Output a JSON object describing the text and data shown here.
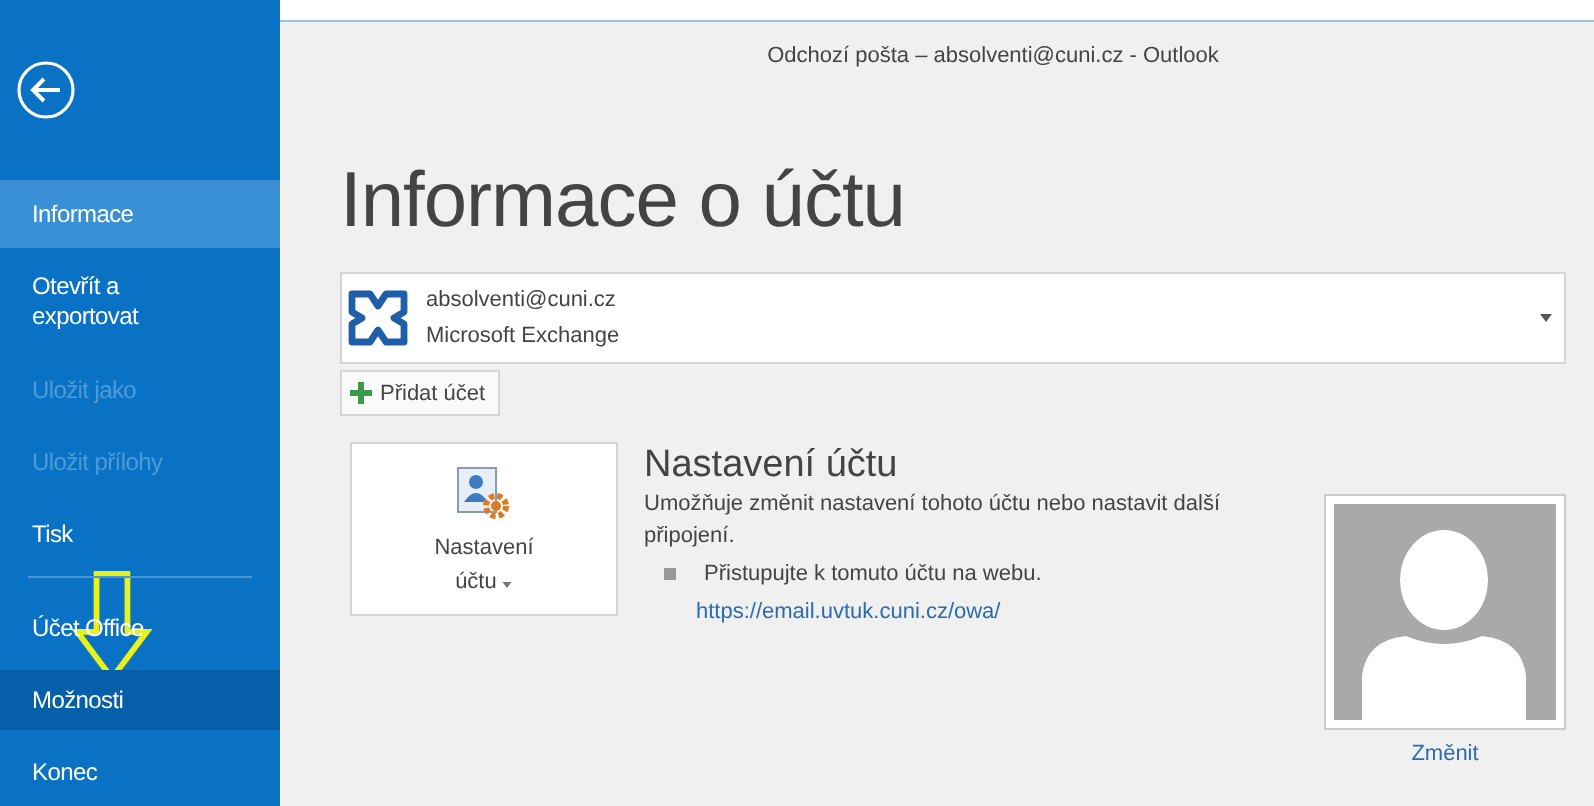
{
  "window": {
    "title": "Odchozí pošta – absolventi@cuni.cz - Outlook"
  },
  "sidebar": {
    "items": [
      {
        "label": "Informace",
        "kind": "item",
        "selected": true,
        "hovered": false,
        "disabled": false
      },
      {
        "label": "Otevřít a exportovat",
        "kind": "item",
        "selected": false,
        "hovered": false,
        "disabled": false
      },
      {
        "label": "Uložit jako",
        "kind": "item",
        "selected": false,
        "hovered": false,
        "disabled": true
      },
      {
        "label": "Uložit přílohy",
        "kind": "item",
        "selected": false,
        "hovered": false,
        "disabled": true
      },
      {
        "label": "Tisk",
        "kind": "item",
        "selected": false,
        "hovered": false,
        "disabled": false
      },
      {
        "kind": "divider"
      },
      {
        "label": "Účet Office",
        "kind": "item",
        "selected": false,
        "hovered": false,
        "disabled": false
      },
      {
        "label": "Možnosti",
        "kind": "item",
        "selected": false,
        "hovered": true,
        "disabled": false
      },
      {
        "label": "Konec",
        "kind": "item",
        "selected": false,
        "hovered": false,
        "disabled": false
      }
    ]
  },
  "heading": "Informace o účtu",
  "account": {
    "email": "absolventi@cuni.cz",
    "type": "Microsoft Exchange"
  },
  "add_account_button": "Přidat účet",
  "account_settings": {
    "button_line1": "Nastavení",
    "button_line2": "účtu",
    "title": "Nastavení účtu",
    "description": "Umožňuje změnit nastavení tohoto účtu nebo nastavit další připojení.",
    "bullet": "Přistupujte k tomuto účtu na webu.",
    "link": "https://email.uvtuk.cuni.cz/owa/"
  },
  "photo": {
    "change_link": "Změnit"
  }
}
